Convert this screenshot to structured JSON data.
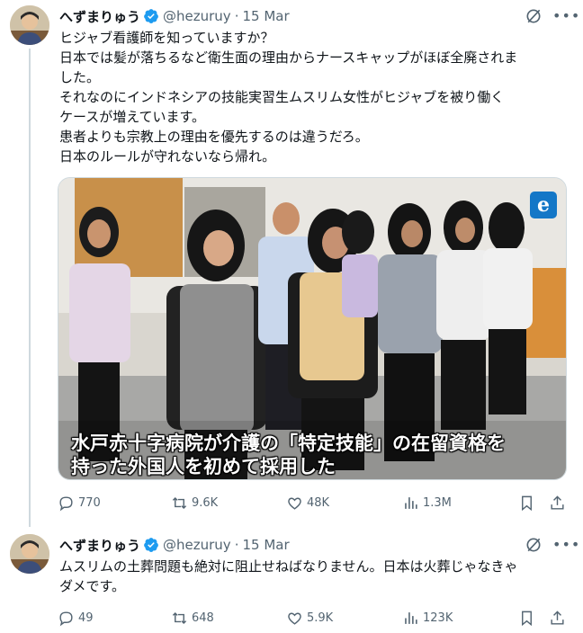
{
  "tweets": [
    {
      "author": {
        "display_name": "へずまりゅう",
        "handle": "@hezuruy",
        "verified": true
      },
      "date": "15 Mar",
      "text_lines": [
        "ヒジャブ看護師を知っていますか？",
        "日本では髪が落ちるなど衛生面の理由からナースキャップがほぼ全廃されま",
        "した。",
        "それなのにインドネシアの技能実習生ムスリム女性がヒジャブを被り働く",
        "ケースが増えています。",
        "患者よりも宗教上の理由を優先するのは違うだろ。",
        "日本のルールが守れないなら帰れ。"
      ],
      "media": {
        "subtitle_line1": "水戸赤十字病院が介護の「特定技能」の在留資格を",
        "subtitle_line2": "持った外国人を初めて採用した",
        "logo_icon": "broadcaster-logo"
      },
      "metrics": {
        "replies": "770",
        "retweets": "9.6K",
        "likes": "48K",
        "views": "1.3M"
      }
    },
    {
      "author": {
        "display_name": "へずまりゅう",
        "handle": "@hezuruy",
        "verified": true
      },
      "date": "15 Mar",
      "text_lines": [
        "ムスリムの土葬問題も絶対に阻止せねばなりません。日本は火葬じゃなきゃ",
        "ダメです。"
      ],
      "metrics": {
        "replies": "49",
        "retweets": "648",
        "likes": "5.9K",
        "views": "123K"
      }
    }
  ],
  "colors": {
    "verified": "#1d9bf0",
    "muted": "#536471",
    "text": "#0f1419",
    "divider": "#cfd9de"
  },
  "separator": "·"
}
